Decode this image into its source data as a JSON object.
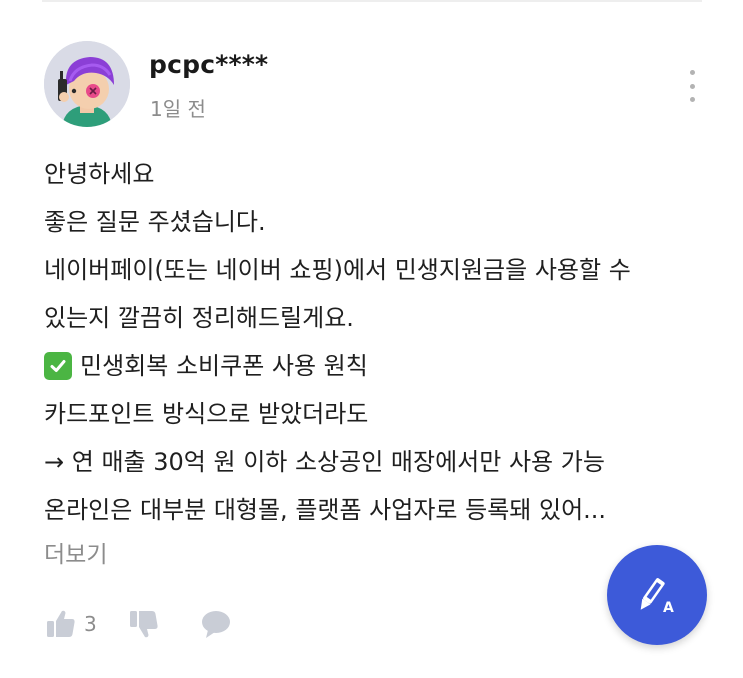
{
  "answer": {
    "username": "pcpc****",
    "timestamp": "1일 전",
    "lines": [
      "안녕하세요",
      "좋은 질문 주셨습니다.",
      "네이버페이(또는 네이버 쇼핑)에서 민생지원금을 사용할 수",
      "있는지 깔끔히 정리해드릴게요.",
      "민생회복 소비쿠폰 사용 원칙",
      "카드포인트 방식으로 받았더라도",
      "→ 연 매출 30억 원 이하 소상공인 매장에서만 사용 가능",
      "온라인은 대부분 대형몰, 플랫폼 사업자로 등록돼 있어..."
    ],
    "see_more_label": "더보기"
  },
  "reactions": {
    "like_count": "3",
    "like_icon": "thumbs-up-icon",
    "dislike_icon": "thumbs-down-icon",
    "comment_icon": "comment-bubble-icon"
  },
  "fab": {
    "icon": "pencil-write-icon",
    "color": "#3d5ad9"
  },
  "colors": {
    "check_emoji": "#4bb543",
    "muted_text": "#8c8c8c"
  }
}
